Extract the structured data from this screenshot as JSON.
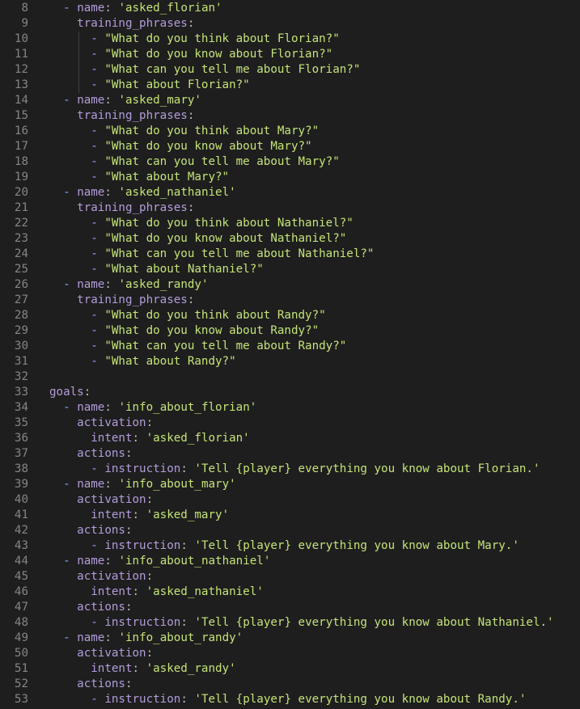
{
  "editor": {
    "lines": [
      {
        "num": "8",
        "tokens": [
          {
            "t": "  ",
            "c": "punc"
          },
          {
            "t": "- ",
            "c": "dash"
          },
          {
            "t": "name",
            "c": "key"
          },
          {
            "t": ": ",
            "c": "punc"
          },
          {
            "t": "'asked_florian'",
            "c": "str"
          }
        ]
      },
      {
        "num": "9",
        "tokens": [
          {
            "t": "    ",
            "c": "punc"
          },
          {
            "t": "training_phrases",
            "c": "key"
          },
          {
            "t": ":",
            "c": "punc"
          }
        ]
      },
      {
        "num": "10",
        "tokens": [
          {
            "t": "      ",
            "c": "punc"
          },
          {
            "t": "- ",
            "c": "dash"
          },
          {
            "t": "\"What do you think about Florian?\"",
            "c": "str"
          }
        ]
      },
      {
        "num": "11",
        "tokens": [
          {
            "t": "      ",
            "c": "punc"
          },
          {
            "t": "- ",
            "c": "dash"
          },
          {
            "t": "\"What do you know about Florian?\"",
            "c": "str"
          }
        ]
      },
      {
        "num": "12",
        "tokens": [
          {
            "t": "      ",
            "c": "punc"
          },
          {
            "t": "- ",
            "c": "dash"
          },
          {
            "t": "\"What can you tell me about Florian?\"",
            "c": "str"
          }
        ]
      },
      {
        "num": "13",
        "tokens": [
          {
            "t": "      ",
            "c": "punc"
          },
          {
            "t": "- ",
            "c": "dash"
          },
          {
            "t": "\"What about Florian?\"",
            "c": "str"
          }
        ]
      },
      {
        "num": "14",
        "tokens": [
          {
            "t": "  ",
            "c": "punc"
          },
          {
            "t": "- ",
            "c": "dash"
          },
          {
            "t": "name",
            "c": "key"
          },
          {
            "t": ": ",
            "c": "punc"
          },
          {
            "t": "'asked_mary'",
            "c": "str"
          }
        ]
      },
      {
        "num": "15",
        "tokens": [
          {
            "t": "    ",
            "c": "punc"
          },
          {
            "t": "training_phrases",
            "c": "key"
          },
          {
            "t": ":",
            "c": "punc"
          }
        ]
      },
      {
        "num": "16",
        "tokens": [
          {
            "t": "      ",
            "c": "punc"
          },
          {
            "t": "- ",
            "c": "dash"
          },
          {
            "t": "\"What do you think about Mary?\"",
            "c": "str"
          }
        ]
      },
      {
        "num": "17",
        "tokens": [
          {
            "t": "      ",
            "c": "punc"
          },
          {
            "t": "- ",
            "c": "dash"
          },
          {
            "t": "\"What do you know about Mary?\"",
            "c": "str"
          }
        ]
      },
      {
        "num": "18",
        "tokens": [
          {
            "t": "      ",
            "c": "punc"
          },
          {
            "t": "- ",
            "c": "dash"
          },
          {
            "t": "\"What can you tell me about Mary?\"",
            "c": "str"
          }
        ]
      },
      {
        "num": "19",
        "tokens": [
          {
            "t": "      ",
            "c": "punc"
          },
          {
            "t": "- ",
            "c": "dash"
          },
          {
            "t": "\"What about Mary?\"",
            "c": "str"
          }
        ]
      },
      {
        "num": "20",
        "tokens": [
          {
            "t": "  ",
            "c": "punc"
          },
          {
            "t": "- ",
            "c": "dash"
          },
          {
            "t": "name",
            "c": "key"
          },
          {
            "t": ": ",
            "c": "punc"
          },
          {
            "t": "'asked_nathaniel'",
            "c": "str"
          }
        ]
      },
      {
        "num": "21",
        "tokens": [
          {
            "t": "    ",
            "c": "punc"
          },
          {
            "t": "training_phrases",
            "c": "key"
          },
          {
            "t": ":",
            "c": "punc"
          }
        ]
      },
      {
        "num": "22",
        "tokens": [
          {
            "t": "      ",
            "c": "punc"
          },
          {
            "t": "- ",
            "c": "dash"
          },
          {
            "t": "\"What do you think about Nathaniel?\"",
            "c": "str"
          }
        ]
      },
      {
        "num": "23",
        "tokens": [
          {
            "t": "      ",
            "c": "punc"
          },
          {
            "t": "- ",
            "c": "dash"
          },
          {
            "t": "\"What do you know about Nathaniel?\"",
            "c": "str"
          }
        ]
      },
      {
        "num": "24",
        "tokens": [
          {
            "t": "      ",
            "c": "punc"
          },
          {
            "t": "- ",
            "c": "dash"
          },
          {
            "t": "\"What can you tell me about Nathaniel?\"",
            "c": "str"
          }
        ]
      },
      {
        "num": "25",
        "tokens": [
          {
            "t": "      ",
            "c": "punc"
          },
          {
            "t": "- ",
            "c": "dash"
          },
          {
            "t": "\"What about Nathaniel?\"",
            "c": "str"
          }
        ]
      },
      {
        "num": "26",
        "tokens": [
          {
            "t": "  ",
            "c": "punc"
          },
          {
            "t": "- ",
            "c": "dash"
          },
          {
            "t": "name",
            "c": "key"
          },
          {
            "t": ": ",
            "c": "punc"
          },
          {
            "t": "'asked_randy'",
            "c": "str"
          }
        ]
      },
      {
        "num": "27",
        "tokens": [
          {
            "t": "    ",
            "c": "punc"
          },
          {
            "t": "training_phrases",
            "c": "key"
          },
          {
            "t": ":",
            "c": "punc"
          }
        ]
      },
      {
        "num": "28",
        "tokens": [
          {
            "t": "      ",
            "c": "punc"
          },
          {
            "t": "- ",
            "c": "dash"
          },
          {
            "t": "\"What do you think about Randy?\"",
            "c": "str"
          }
        ]
      },
      {
        "num": "29",
        "tokens": [
          {
            "t": "      ",
            "c": "punc"
          },
          {
            "t": "- ",
            "c": "dash"
          },
          {
            "t": "\"What do you know about Randy?\"",
            "c": "str"
          }
        ]
      },
      {
        "num": "30",
        "tokens": [
          {
            "t": "      ",
            "c": "punc"
          },
          {
            "t": "- ",
            "c": "dash"
          },
          {
            "t": "\"What can you tell me about Randy?\"",
            "c": "str"
          }
        ]
      },
      {
        "num": "31",
        "tokens": [
          {
            "t": "      ",
            "c": "punc"
          },
          {
            "t": "- ",
            "c": "dash"
          },
          {
            "t": "\"What about Randy?\"",
            "c": "str"
          }
        ]
      },
      {
        "num": "32",
        "tokens": []
      },
      {
        "num": "33",
        "tokens": [
          {
            "t": "goals",
            "c": "key"
          },
          {
            "t": ":",
            "c": "punc"
          }
        ]
      },
      {
        "num": "34",
        "tokens": [
          {
            "t": "  ",
            "c": "punc"
          },
          {
            "t": "- ",
            "c": "dash"
          },
          {
            "t": "name",
            "c": "key"
          },
          {
            "t": ": ",
            "c": "punc"
          },
          {
            "t": "'info_about_florian'",
            "c": "str"
          }
        ]
      },
      {
        "num": "35",
        "tokens": [
          {
            "t": "    ",
            "c": "punc"
          },
          {
            "t": "activation",
            "c": "key"
          },
          {
            "t": ":",
            "c": "punc"
          }
        ]
      },
      {
        "num": "36",
        "tokens": [
          {
            "t": "      ",
            "c": "punc"
          },
          {
            "t": "intent",
            "c": "key"
          },
          {
            "t": ": ",
            "c": "punc"
          },
          {
            "t": "'asked_florian'",
            "c": "str"
          }
        ]
      },
      {
        "num": "37",
        "tokens": [
          {
            "t": "    ",
            "c": "punc"
          },
          {
            "t": "actions",
            "c": "key"
          },
          {
            "t": ":",
            "c": "punc"
          }
        ]
      },
      {
        "num": "38",
        "tokens": [
          {
            "t": "      ",
            "c": "punc"
          },
          {
            "t": "- ",
            "c": "dash"
          },
          {
            "t": "instruction",
            "c": "key"
          },
          {
            "t": ": ",
            "c": "punc"
          },
          {
            "t": "'Tell {player} everything you know about Florian.'",
            "c": "str"
          }
        ]
      },
      {
        "num": "39",
        "tokens": [
          {
            "t": "  ",
            "c": "punc"
          },
          {
            "t": "- ",
            "c": "dash"
          },
          {
            "t": "name",
            "c": "key"
          },
          {
            "t": ": ",
            "c": "punc"
          },
          {
            "t": "'info_about_mary'",
            "c": "str"
          }
        ]
      },
      {
        "num": "40",
        "tokens": [
          {
            "t": "    ",
            "c": "punc"
          },
          {
            "t": "activation",
            "c": "key"
          },
          {
            "t": ":",
            "c": "punc"
          }
        ]
      },
      {
        "num": "41",
        "tokens": [
          {
            "t": "      ",
            "c": "punc"
          },
          {
            "t": "intent",
            "c": "key"
          },
          {
            "t": ": ",
            "c": "punc"
          },
          {
            "t": "'asked_mary'",
            "c": "str"
          }
        ]
      },
      {
        "num": "42",
        "tokens": [
          {
            "t": "    ",
            "c": "punc"
          },
          {
            "t": "actions",
            "c": "key"
          },
          {
            "t": ":",
            "c": "punc"
          }
        ]
      },
      {
        "num": "43",
        "tokens": [
          {
            "t": "      ",
            "c": "punc"
          },
          {
            "t": "- ",
            "c": "dash"
          },
          {
            "t": "instruction",
            "c": "key"
          },
          {
            "t": ": ",
            "c": "punc"
          },
          {
            "t": "'Tell {player} everything you know about Mary.'",
            "c": "str"
          }
        ]
      },
      {
        "num": "44",
        "tokens": [
          {
            "t": "  ",
            "c": "punc"
          },
          {
            "t": "- ",
            "c": "dash"
          },
          {
            "t": "name",
            "c": "key"
          },
          {
            "t": ": ",
            "c": "punc"
          },
          {
            "t": "'info_about_nathaniel'",
            "c": "str"
          }
        ]
      },
      {
        "num": "45",
        "tokens": [
          {
            "t": "    ",
            "c": "punc"
          },
          {
            "t": "activation",
            "c": "key"
          },
          {
            "t": ":",
            "c": "punc"
          }
        ]
      },
      {
        "num": "46",
        "tokens": [
          {
            "t": "      ",
            "c": "punc"
          },
          {
            "t": "intent",
            "c": "key"
          },
          {
            "t": ": ",
            "c": "punc"
          },
          {
            "t": "'asked_nathaniel'",
            "c": "str"
          }
        ]
      },
      {
        "num": "47",
        "tokens": [
          {
            "t": "    ",
            "c": "punc"
          },
          {
            "t": "actions",
            "c": "key"
          },
          {
            "t": ":",
            "c": "punc"
          }
        ]
      },
      {
        "num": "48",
        "tokens": [
          {
            "t": "      ",
            "c": "punc"
          },
          {
            "t": "- ",
            "c": "dash"
          },
          {
            "t": "instruction",
            "c": "key"
          },
          {
            "t": ": ",
            "c": "punc"
          },
          {
            "t": "'Tell {player} everything you know about Nathaniel.'",
            "c": "str"
          }
        ]
      },
      {
        "num": "49",
        "tokens": [
          {
            "t": "  ",
            "c": "punc"
          },
          {
            "t": "- ",
            "c": "dash"
          },
          {
            "t": "name",
            "c": "key"
          },
          {
            "t": ": ",
            "c": "punc"
          },
          {
            "t": "'info_about_randy'",
            "c": "str"
          }
        ]
      },
      {
        "num": "50",
        "tokens": [
          {
            "t": "    ",
            "c": "punc"
          },
          {
            "t": "activation",
            "c": "key"
          },
          {
            "t": ":",
            "c": "punc"
          }
        ]
      },
      {
        "num": "51",
        "tokens": [
          {
            "t": "      ",
            "c": "punc"
          },
          {
            "t": "intent",
            "c": "key"
          },
          {
            "t": ": ",
            "c": "punc"
          },
          {
            "t": "'asked_randy'",
            "c": "str"
          }
        ]
      },
      {
        "num": "52",
        "tokens": [
          {
            "t": "    ",
            "c": "punc"
          },
          {
            "t": "actions",
            "c": "key"
          },
          {
            "t": ":",
            "c": "punc"
          }
        ]
      },
      {
        "num": "53",
        "tokens": [
          {
            "t": "      ",
            "c": "punc"
          },
          {
            "t": "- ",
            "c": "dash"
          },
          {
            "t": "instruction",
            "c": "key"
          },
          {
            "t": ": ",
            "c": "punc"
          },
          {
            "t": "'Tell {player} everything you know about Randy.'",
            "c": "str"
          }
        ]
      }
    ]
  },
  "colors": {
    "background": "#1e1e1e",
    "line_number": "#858585",
    "key": "#b39ddb",
    "string": "#c5e478",
    "dash": "#8fa0ff",
    "indent_guide": "#404040"
  }
}
